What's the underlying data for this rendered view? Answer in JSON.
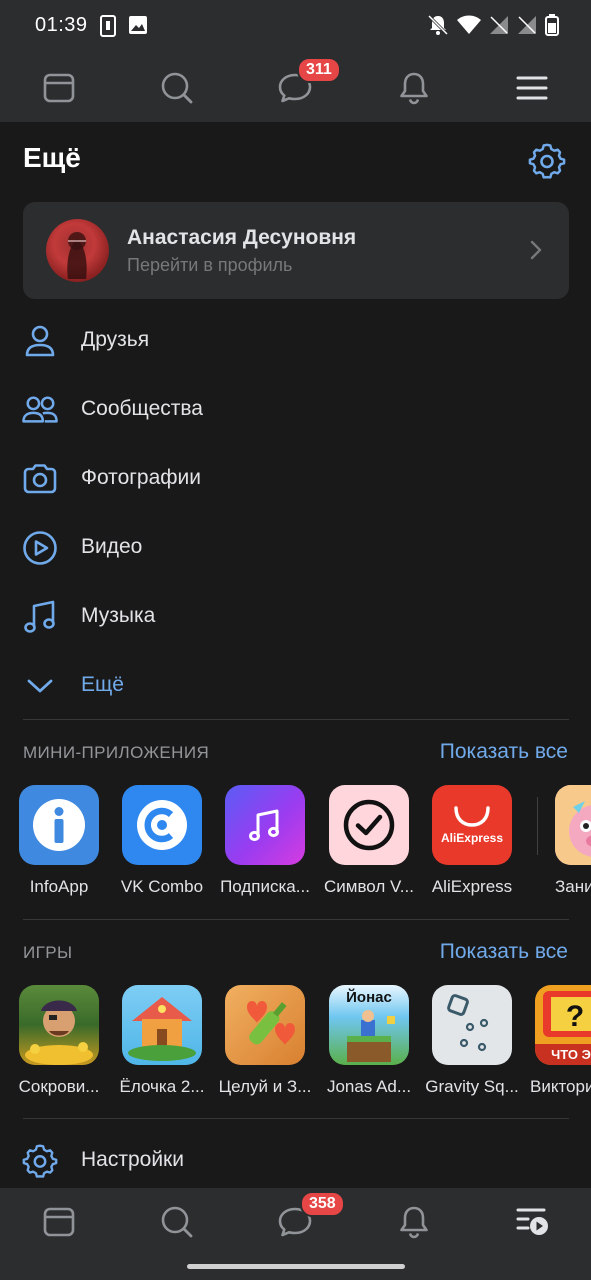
{
  "status_bar": {
    "time": "01:39",
    "left_icons": [
      "sim-icon",
      "image-icon"
    ],
    "right_icons": [
      "bell-off-icon",
      "wifi-icon",
      "no-signal-icon",
      "no-signal-icon",
      "battery-icon"
    ]
  },
  "top_nav": {
    "items": [
      {
        "name": "news-icon"
      },
      {
        "name": "search-icon"
      },
      {
        "name": "messages-icon",
        "badge": "311"
      },
      {
        "name": "notifications-icon"
      },
      {
        "name": "menu-icon"
      }
    ]
  },
  "header": {
    "title": "Ещё",
    "settings_icon": "gear-icon"
  },
  "profile": {
    "name": "Анастасия Десуновня",
    "subtitle": "Перейти в профиль"
  },
  "menu": {
    "items": [
      {
        "label": "Друзья",
        "icon": "person-icon"
      },
      {
        "label": "Сообщества",
        "icon": "people-icon"
      },
      {
        "label": "Фотографии",
        "icon": "camera-icon"
      },
      {
        "label": "Видео",
        "icon": "play-icon"
      },
      {
        "label": "Музыка",
        "icon": "music-icon"
      }
    ],
    "more_label": "Ещё"
  },
  "mini_apps": {
    "heading": "МИНИ-ПРИЛОЖЕНИЯ",
    "show_all": "Показать все",
    "apps": [
      {
        "label": "InfoApp",
        "color": "#3f8ae0"
      },
      {
        "label": "VK Combo",
        "color": "#2f88f0"
      },
      {
        "label": "Подписка...",
        "color": "#8f3bf0"
      },
      {
        "label": "Символ V...",
        "color": "#ffd6dc"
      },
      {
        "label": "AliExpress",
        "color": "#e8392b",
        "icon_text": "AliExpress"
      },
      {
        "label": "Зани",
        "color": "#f7c98a"
      }
    ]
  },
  "games": {
    "heading": "ИГРЫ",
    "show_all": "Показать все",
    "apps": [
      {
        "label": "Сокрови...",
        "color": "#3b6a2a"
      },
      {
        "label": "Ёлочка 2...",
        "color": "#4fb6e8"
      },
      {
        "label": "Целуй и З...",
        "color": "#e8a04a"
      },
      {
        "label": "Jonas Ad...",
        "color": "#6fc6f0",
        "icon_text": "Йонас"
      },
      {
        "label": "Gravity Sq...",
        "color": "#e3e6e9"
      },
      {
        "label": "Виктори",
        "color": "#f0a020",
        "icon_text": "ЧТО ЭТ"
      }
    ]
  },
  "settings_item": {
    "label": "Настройки",
    "icon": "gear-icon"
  },
  "bottom_nav": {
    "items": [
      {
        "name": "news-icon"
      },
      {
        "name": "search-icon"
      },
      {
        "name": "messages-icon",
        "badge": "358"
      },
      {
        "name": "notifications-icon"
      },
      {
        "name": "services-icon"
      }
    ]
  }
}
